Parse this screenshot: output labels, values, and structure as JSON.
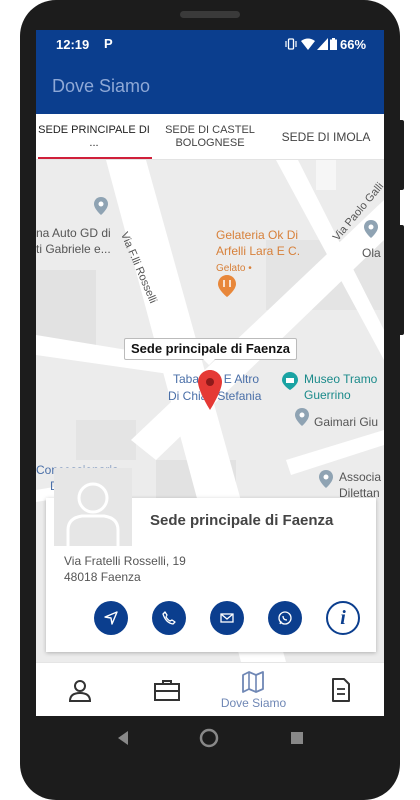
{
  "status_bar": {
    "time": "12:19",
    "notification_icon": "P",
    "battery": "66%"
  },
  "app_bar": {
    "title": "Dove Siamo"
  },
  "tabs": [
    {
      "label": "SEDE PRINCIPALE DI ..."
    },
    {
      "label": "SEDE DI CASTEL BOLOGNESE"
    },
    {
      "label": "SEDE DI IMOLA"
    }
  ],
  "map": {
    "streets": [
      "Via F.lli Rosselli",
      "Via Paolo Galli"
    ],
    "places": {
      "auto_gd_line1": "na Auto GD di",
      "auto_gd_line2": "ti Gabriele e...",
      "gelateria_line1": "Gelateria Ok Di",
      "gelateria_line2": "Arfelli Lara E C.",
      "gelateria_sub": "Gelato •",
      "ola": "Ola",
      "tabacchi_line1": "Tabacchi E Altro",
      "tabacchi_line2": "Di Chiari Stefania",
      "museo_line1": "Museo Tramo",
      "museo_line2": "Guerrino",
      "gaimari": "Gaimari Giu",
      "concessionaria_line1": "Concessionaria",
      "concessionaria_line2": "D",
      "associa_line1": "Associa",
      "associa_line2": "Dilettan"
    },
    "marker_callout": "Sede principale di Faenza"
  },
  "location_card": {
    "name": "Sede principale di Faenza",
    "address_line1": "Via Fratelli Rosselli, 19",
    "address_line2": "48018 Faenza",
    "actions": [
      "directions-icon",
      "phone-icon",
      "email-icon",
      "whatsapp-icon",
      "info-icon"
    ],
    "info_label": "i"
  },
  "bottom_nav": [
    {
      "icon": "person-icon",
      "label": ""
    },
    {
      "icon": "briefcase-icon",
      "label": ""
    },
    {
      "icon": "map-icon",
      "label": "Dove Siamo"
    },
    {
      "icon": "document-icon",
      "label": ""
    }
  ],
  "colors": {
    "primary": "#0b3e8e",
    "accent": "#d0203a",
    "map_poi_orange": "#e8873a",
    "map_poi_teal": "#1aa3a3"
  }
}
